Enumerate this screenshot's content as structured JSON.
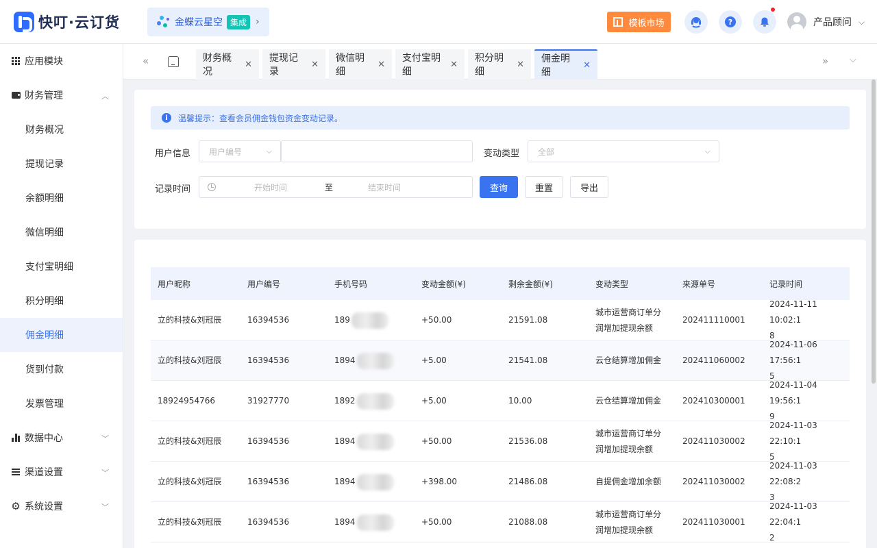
{
  "app": {
    "logo_text": "快叮·云订货"
  },
  "integration": {
    "label": "金蝶云星空",
    "badge": "集成"
  },
  "header": {
    "market_label": "模板市场",
    "user_name": "产品顾问"
  },
  "sidebar": {
    "groups": [
      {
        "label": "应用模块"
      },
      {
        "label": "财务管理"
      },
      {
        "label": "数据中心"
      },
      {
        "label": "渠道设置"
      },
      {
        "label": "系统设置"
      }
    ],
    "items": [
      {
        "label": "财务概况"
      },
      {
        "label": "提现记录"
      },
      {
        "label": "余额明细"
      },
      {
        "label": "微信明细"
      },
      {
        "label": "支付宝明细"
      },
      {
        "label": "积分明细"
      },
      {
        "label": "佣金明细"
      },
      {
        "label": "货到付款"
      },
      {
        "label": "发票管理"
      }
    ],
    "active_item": "佣金明细"
  },
  "tabs": [
    {
      "label": "财务概况"
    },
    {
      "label": "提现记录"
    },
    {
      "label": "微信明细"
    },
    {
      "label": "支付宝明细"
    },
    {
      "label": "积分明细"
    },
    {
      "label": "佣金明细"
    }
  ],
  "active_tab": "佣金明细",
  "notice": "温馨提示：查看会员佣金钱包资金变动记录。",
  "filters": {
    "user_info_label": "用户信息",
    "user_info_select": "用户编号",
    "user_info_value": "",
    "change_type_label": "变动类型",
    "change_type_value": "全部",
    "record_time_label": "记录时间",
    "start_placeholder": "开始时间",
    "range_sep": "至",
    "end_placeholder": "结束时间",
    "query_label": "查询",
    "reset_label": "重置",
    "export_label": "导出"
  },
  "table": {
    "columns": [
      "用户昵称",
      "用户编号",
      "手机号码",
      "变动金额(¥)",
      "剩余金额(¥)",
      "变动类型",
      "来源单号",
      "记录时间"
    ],
    "rows": [
      {
        "nickname": "立的科技&刘冠辰",
        "user_no": "16394536",
        "phone": "189",
        "change": "+50.00",
        "remain": "21591.08",
        "type_l1": "城市运营商订单分",
        "type_l2": "润增加提现余额",
        "source": "202411110001",
        "time_l1": "2024-11-11 10:02:1",
        "time_l2": "8"
      },
      {
        "nickname": "立的科技&刘冠辰",
        "user_no": "16394536",
        "phone": "1894",
        "change": "+5.00",
        "remain": "21541.08",
        "type_l1": "云仓结算增加佣金",
        "type_l2": "",
        "source": "202411060002",
        "time_l1": "2024-11-06 17:56:1",
        "time_l2": "5"
      },
      {
        "nickname": "18924954766",
        "user_no": "31927770",
        "phone": "1892",
        "change": "+5.00",
        "remain": "10.00",
        "type_l1": "云仓结算增加佣金",
        "type_l2": "",
        "source": "202410300001",
        "time_l1": "2024-11-04 19:56:1",
        "time_l2": "9"
      },
      {
        "nickname": "立的科技&刘冠辰",
        "user_no": "16394536",
        "phone": "1894",
        "change": "+50.00",
        "remain": "21536.08",
        "type_l1": "城市运营商订单分",
        "type_l2": "润增加提现余额",
        "source": "202411030002",
        "time_l1": "2024-11-03 22:10:1",
        "time_l2": "5"
      },
      {
        "nickname": "立的科技&刘冠辰",
        "user_no": "16394536",
        "phone": "1894",
        "change": "+398.00",
        "remain": "21486.08",
        "type_l1": "自提佣金增加余额",
        "type_l2": "",
        "source": "202411030002",
        "time_l1": "2024-11-03 22:08:2",
        "time_l2": "3"
      },
      {
        "nickname": "立的科技&刘冠辰",
        "user_no": "16394536",
        "phone": "1894",
        "change": "+50.00",
        "remain": "21088.08",
        "type_l1": "城市运营商订单分",
        "type_l2": "润增加提现余额",
        "source": "202411030001",
        "time_l1": "2024-11-03 22:04:1",
        "time_l2": "2"
      }
    ]
  },
  "colors": {
    "primary": "#3a73f0",
    "market": "#ff8a3d",
    "badge": "#15c3b4"
  }
}
